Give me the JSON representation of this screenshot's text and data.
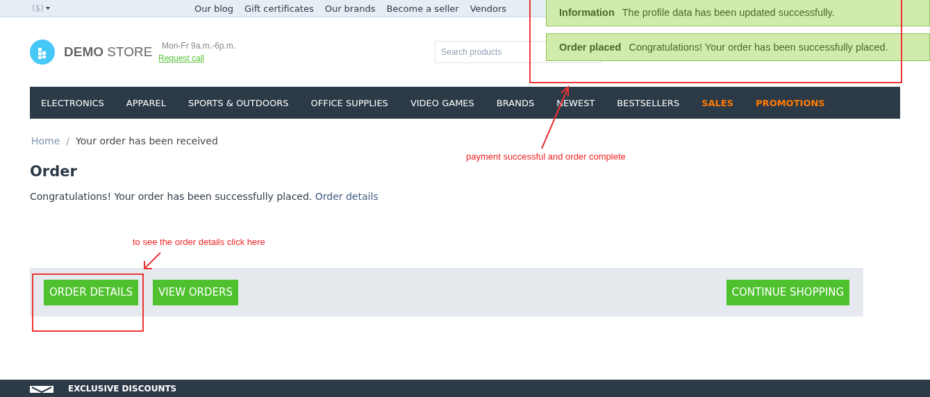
{
  "top_bar": {
    "currency": "($)",
    "links": [
      "Our blog",
      "Gift certificates",
      "Our brands",
      "Become a seller",
      "Vendors"
    ]
  },
  "header": {
    "logo_bold": "DEMO",
    "logo_light": "STORE",
    "hours": "Mon-Fr 9a.m.-6p.m.",
    "request_call": "Request call",
    "search": {
      "placeholder": "Search products"
    }
  },
  "nav": [
    {
      "label": "ELECTRONICS",
      "kind": "normal"
    },
    {
      "label": "APPAREL",
      "kind": "normal"
    },
    {
      "label": "SPORTS & OUTDOORS",
      "kind": "normal"
    },
    {
      "label": "OFFICE SUPPLIES",
      "kind": "normal"
    },
    {
      "label": "VIDEO GAMES",
      "kind": "normal"
    },
    {
      "label": "BRANDS",
      "kind": "normal"
    },
    {
      "label": "NEWEST",
      "kind": "normal"
    },
    {
      "label": "BESTSELLERS",
      "kind": "normal"
    },
    {
      "label": "SALES",
      "kind": "highlight"
    },
    {
      "label": "PROMOTIONS",
      "kind": "highlight"
    }
  ],
  "breadcrumbs": [
    "Home",
    "Your order has been received"
  ],
  "breadcrumb_separator": "/",
  "page": {
    "title": "Order",
    "message": "Congratulations! Your order has been successfully placed.",
    "link": "Order details"
  },
  "buttons": {
    "left": [
      "ORDER DETAILS",
      "VIEW ORDERS"
    ],
    "right": "CONTINUE SHOPPING"
  },
  "notifications": [
    {
      "title": "Information",
      "text": "The profile data has been updated successfully."
    },
    {
      "title": "Order placed",
      "text": "Congratulations! Your order has been successfully placed."
    }
  ],
  "annotations": [
    {
      "text": "payment successful and order complete"
    },
    {
      "text": "to see the order details click here"
    }
  ],
  "footer": {
    "heading": "EXCLUSIVE DISCOUNTS"
  }
}
